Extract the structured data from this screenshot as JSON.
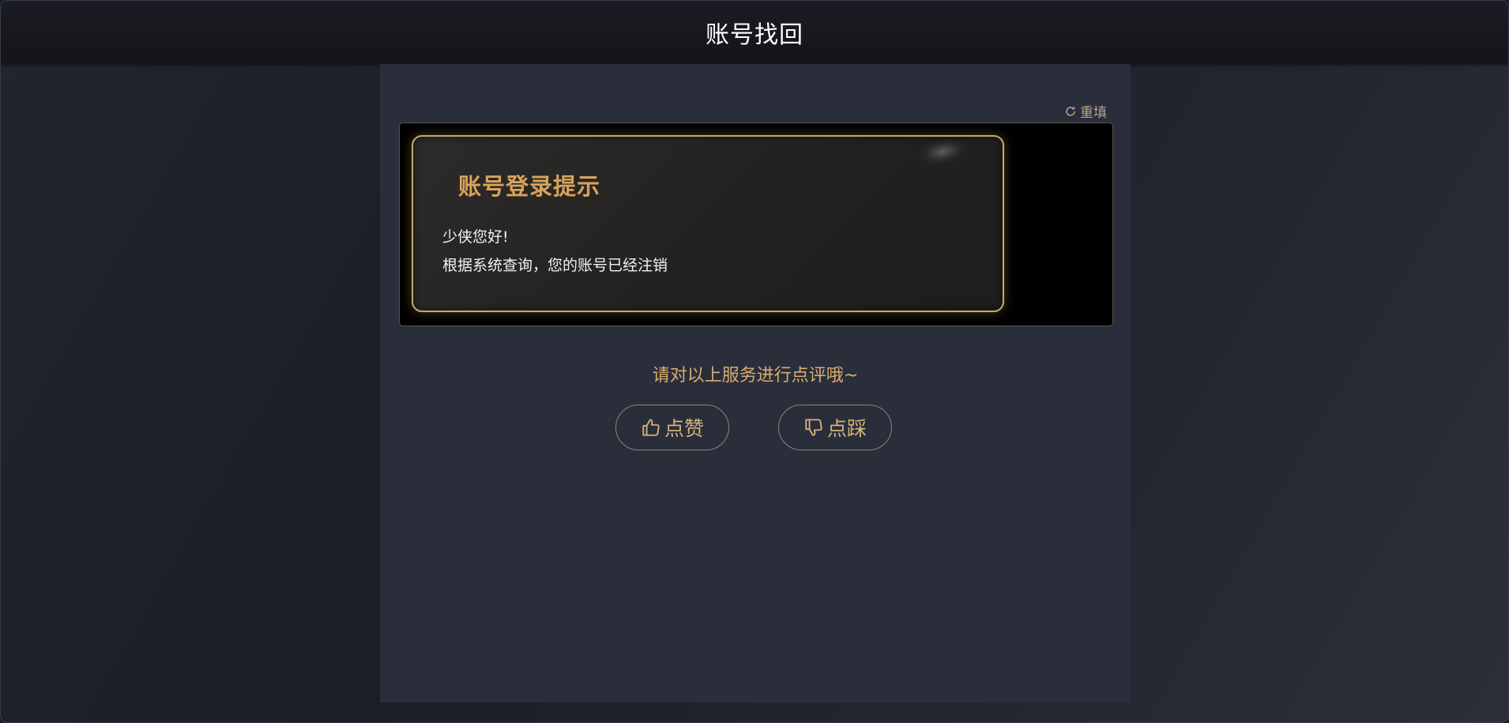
{
  "header": {
    "title": "账号找回"
  },
  "toolbar": {
    "reset_label": "重填",
    "reset_icon": "refresh-icon"
  },
  "notice": {
    "title": "账号登录提示",
    "greeting": "少侠您好!",
    "message": "根据系统查询，您的账号已经注销"
  },
  "rating": {
    "prompt": "请对以上服务进行点评哦~",
    "like_label": "点赞",
    "like_icon": "thumbs-up-icon",
    "dislike_label": "点踩",
    "dislike_icon": "thumbs-down-icon"
  },
  "colors": {
    "accent_gold": "#d7a35a",
    "panel_bg": "#2a2e3b",
    "header_bg": "#14151b"
  }
}
